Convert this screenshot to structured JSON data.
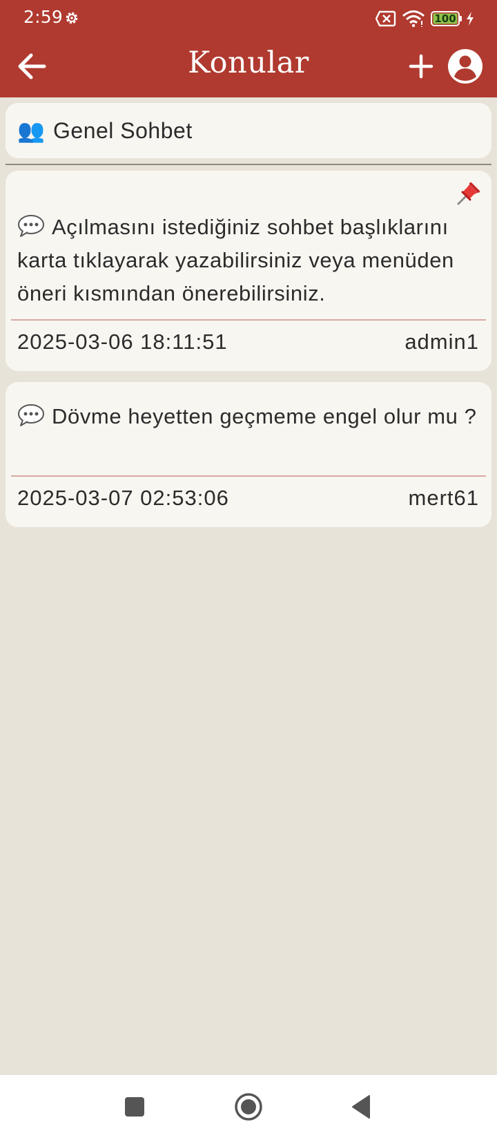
{
  "status_bar": {
    "time": "2:59",
    "battery": "100"
  },
  "toolbar": {
    "title": "Konular"
  },
  "category": {
    "icon": "👥",
    "label": "Genel Sohbet"
  },
  "topics": [
    {
      "text": "Açılmasını istediğiniz sohbet başlıklarını karta tıklayarak yazabilirsiniz veya menüden öneri kısmından önerebilirsiniz.",
      "date": "2025-03-06 18:11:51",
      "author": "admin1",
      "pinned": true
    },
    {
      "text": "Dövme heyetten geçmeme engel olur mu ?",
      "date": "2025-03-07 02:53:06",
      "author": "mert61",
      "pinned": false
    }
  ],
  "colors": {
    "app_bar": "#b03a2f",
    "background": "#e8e3d8",
    "card": "#f8f6f1",
    "separator": "#d8a8a2",
    "battery_fill": "#8bc34a"
  },
  "icons": {
    "back": "arrow-left-icon",
    "add": "plus-icon",
    "profile": "account-circle-icon",
    "category": "people-icon",
    "topic": "speech-bubble-icon",
    "pinned": "pushpin-icon"
  }
}
